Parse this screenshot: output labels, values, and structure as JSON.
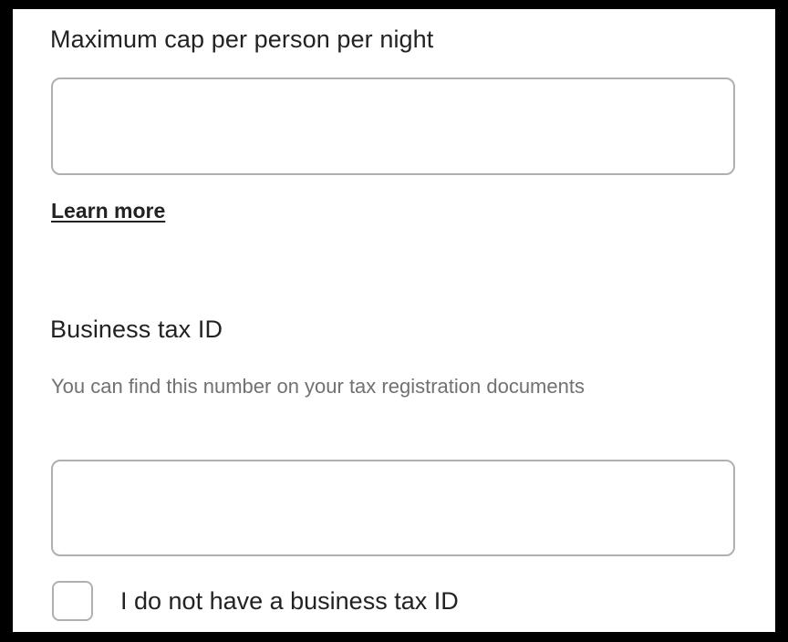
{
  "form": {
    "cap_field": {
      "label": "Maximum cap per person per night",
      "value": "",
      "learn_more": "Learn more"
    },
    "tax_id_field": {
      "label": "Business tax ID",
      "helper": "You can find this number on your tax registration documents",
      "value": ""
    },
    "no_tax_id_checkbox": {
      "label": "I do not have a business tax ID",
      "checked": false
    }
  }
}
